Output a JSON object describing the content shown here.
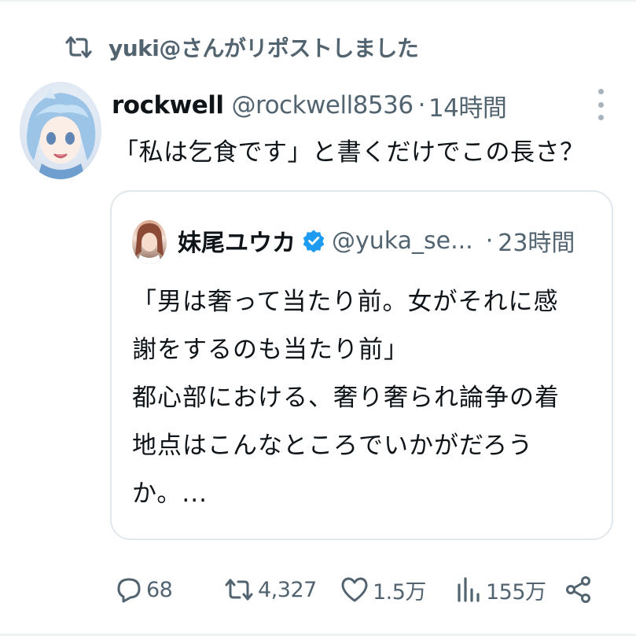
{
  "repost": {
    "icon": "repost-icon",
    "text": "yuki@さんがリポストしました"
  },
  "tweet": {
    "avatar": "user-avatar",
    "name": "rockwell",
    "handle": "@rockwell8536",
    "separator": "·",
    "time": "14時間",
    "more_icon": "more-options-icon",
    "text": "「私は乞食です」と書くだけでこの長さ？"
  },
  "quote": {
    "avatar": "quoted-user-avatar",
    "name": "妹尾ユウカ",
    "verified_icon": "verified-badge-icon",
    "handle": "@yuka_se...",
    "separator": "·",
    "time": "23時間",
    "lines": [
      "「男は奢って当たり前。女がそれに感",
      "謝をするのも当たり前」",
      "都心部における、奢り奢られ論争の着",
      "地点はこんなところでいかがだろう",
      "か。..."
    ]
  },
  "actions": {
    "replies": "68",
    "reposts": "4,327",
    "likes": "1.5万",
    "views": "155万",
    "icons": [
      "reply-icon",
      "repost-icon",
      "like-icon",
      "views-icon",
      "share-icon"
    ]
  },
  "colors": {
    "text_primary": "#0f1419",
    "text_secondary": "#536471",
    "verified": "#1d9bf0",
    "border": "#e1e8ed"
  }
}
